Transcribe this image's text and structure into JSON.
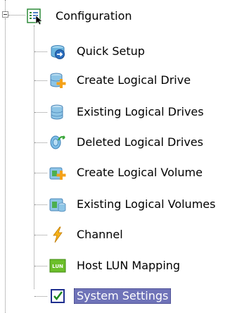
{
  "tree": {
    "root": {
      "label": "Configuration",
      "icon": "configuration-icon",
      "expanded": true
    },
    "items": [
      {
        "label": "Quick Setup",
        "icon": "quick-setup-icon",
        "selected": false
      },
      {
        "label": "Create Logical Drive",
        "icon": "create-logical-drive-icon",
        "selected": false
      },
      {
        "label": "Existing Logical Drives",
        "icon": "existing-logical-drives-icon",
        "selected": false
      },
      {
        "label": "Deleted Logical Drives",
        "icon": "deleted-logical-drives-icon",
        "selected": false
      },
      {
        "label": "Create Logical Volume",
        "icon": "create-logical-volume-icon",
        "selected": false
      },
      {
        "label": "Existing Logical Volumes",
        "icon": "existing-logical-volumes-icon",
        "selected": false
      },
      {
        "label": "Channel",
        "icon": "channel-icon",
        "selected": false
      },
      {
        "label": "Host LUN Mapping",
        "icon": "host-lun-mapping-icon",
        "selected": false,
        "badge_text": "LUN"
      },
      {
        "label": "System Settings",
        "icon": "system-settings-icon",
        "selected": true
      }
    ]
  },
  "colors": {
    "selection_background": "#6f73b8",
    "selection_text": "#ffffff",
    "tree_line": "#8a8a8a"
  }
}
